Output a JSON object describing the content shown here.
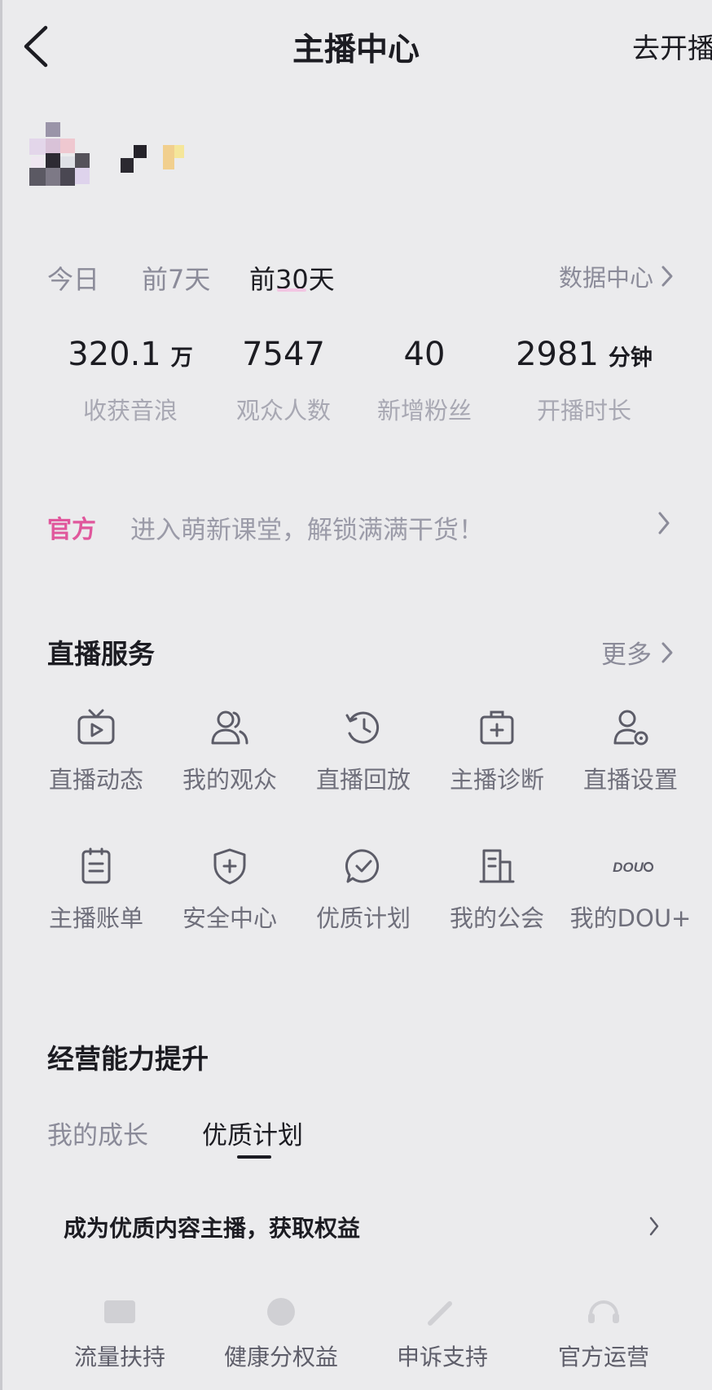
{
  "header": {
    "title": "主播中心",
    "go_live": "去开播"
  },
  "period_tabs": [
    "今日",
    "前7天",
    "前30天"
  ],
  "active_period": "前30天",
  "data_center_link": "数据中心",
  "stats": [
    {
      "value": "320.1",
      "unit": "万",
      "label": "收获音浪"
    },
    {
      "value": "7547",
      "unit": "",
      "label": "观众人数"
    },
    {
      "value": "40",
      "unit": "",
      "label": "新增粉丝"
    },
    {
      "value": "2981",
      "unit": "分钟",
      "label": "开播时长"
    }
  ],
  "banner": {
    "tag": "官方",
    "text": "进入萌新课堂，解锁满满干货！"
  },
  "live_services": {
    "title": "直播服务",
    "more": "更多",
    "items": [
      {
        "label": "直播动态",
        "icon": "tv-play-icon"
      },
      {
        "label": "我的观众",
        "icon": "users-icon"
      },
      {
        "label": "直播回放",
        "icon": "history-icon"
      },
      {
        "label": "主播诊断",
        "icon": "medical-kit-icon"
      },
      {
        "label": "直播设置",
        "icon": "user-settings-icon"
      },
      {
        "label": "主播账单",
        "icon": "bill-icon"
      },
      {
        "label": "安全中心",
        "icon": "shield-plus-icon"
      },
      {
        "label": "优质计划",
        "icon": "chat-check-icon"
      },
      {
        "label": "我的公会",
        "icon": "building-icon"
      },
      {
        "label": "我的DOU+",
        "icon": "dou-plus-icon",
        "icon_text": "DOU"
      }
    ]
  },
  "growth": {
    "title": "经营能力提升",
    "tabs": [
      "我的成长",
      "优质计划"
    ],
    "active_tab": "优质计划",
    "quality_row": "成为优质内容主播，获取权益",
    "benefits": [
      {
        "label": "流量扶持",
        "icon": "traffic-icon"
      },
      {
        "label": "健康分权益",
        "icon": "health-score-icon"
      },
      {
        "label": "申诉支持",
        "icon": "appeal-icon"
      },
      {
        "label": "官方运营",
        "icon": "headset-icon"
      }
    ]
  },
  "colors": {
    "background": "#ebebed",
    "primary_text": "#1c1c22",
    "muted_text": "#8b8b99",
    "official_tag": "#e0579c"
  }
}
